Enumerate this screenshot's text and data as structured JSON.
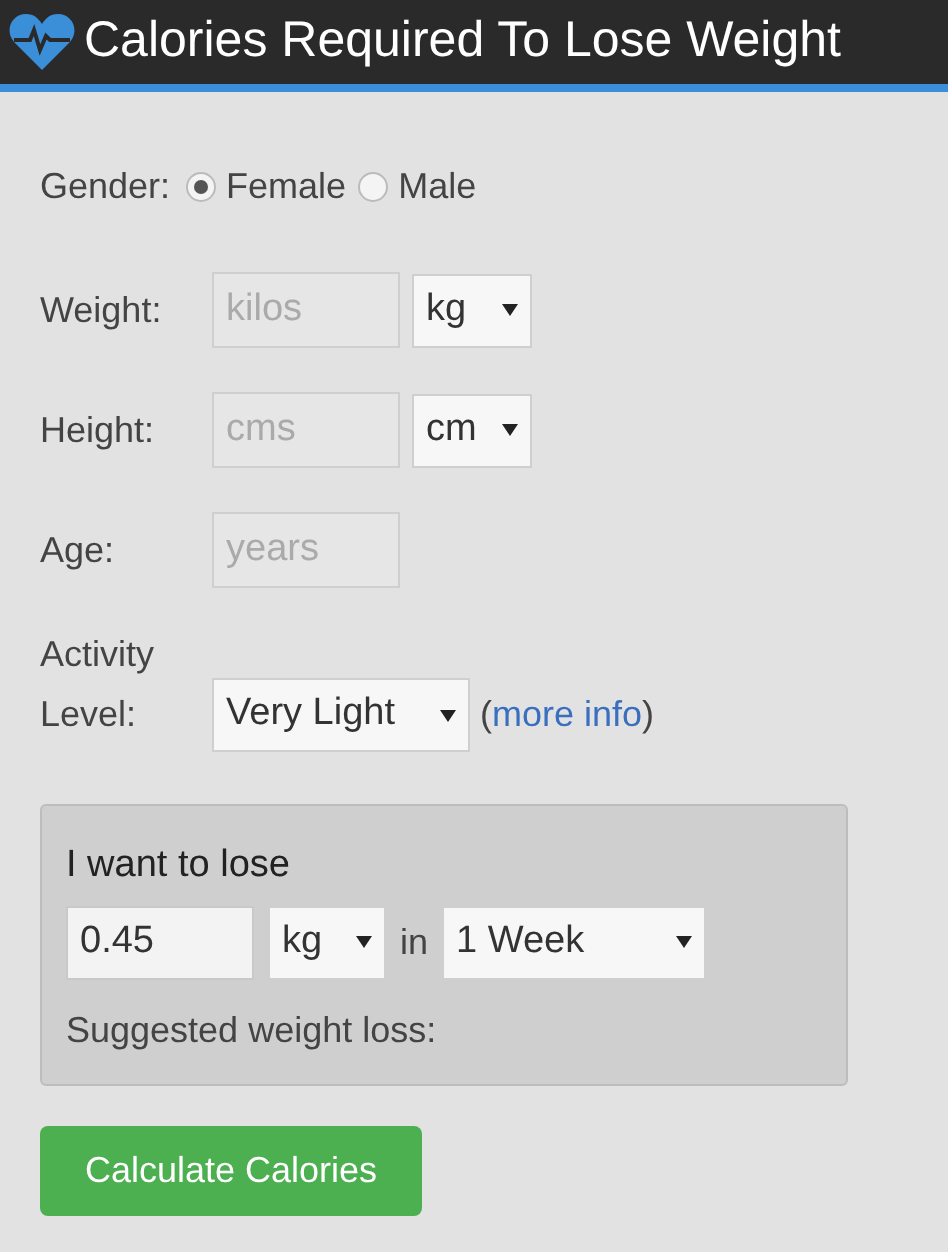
{
  "header": {
    "title": "Calories Required To Lose Weight"
  },
  "gender": {
    "label": "Gender:",
    "options": [
      {
        "label": "Female",
        "selected": true
      },
      {
        "label": "Male",
        "selected": false
      }
    ]
  },
  "fields": [
    {
      "label": "Weight:",
      "placeholder": "kilos",
      "unit": "kg"
    },
    {
      "label": "Height:",
      "placeholder": "cms",
      "unit": "cm"
    },
    {
      "label": "Age:",
      "placeholder": "years"
    }
  ],
  "activity": {
    "label_lines": [
      "Activity",
      "Level:"
    ],
    "value": "Very Light",
    "info_open": "(",
    "info_link": "more info",
    "info_close": ")"
  },
  "lose_box": {
    "title": "I want to lose",
    "amount": "0.45",
    "unit": "kg",
    "connector": "in",
    "period": "1 Week",
    "suggested": "Suggested weight loss:"
  },
  "button": "Calculate Calories"
}
